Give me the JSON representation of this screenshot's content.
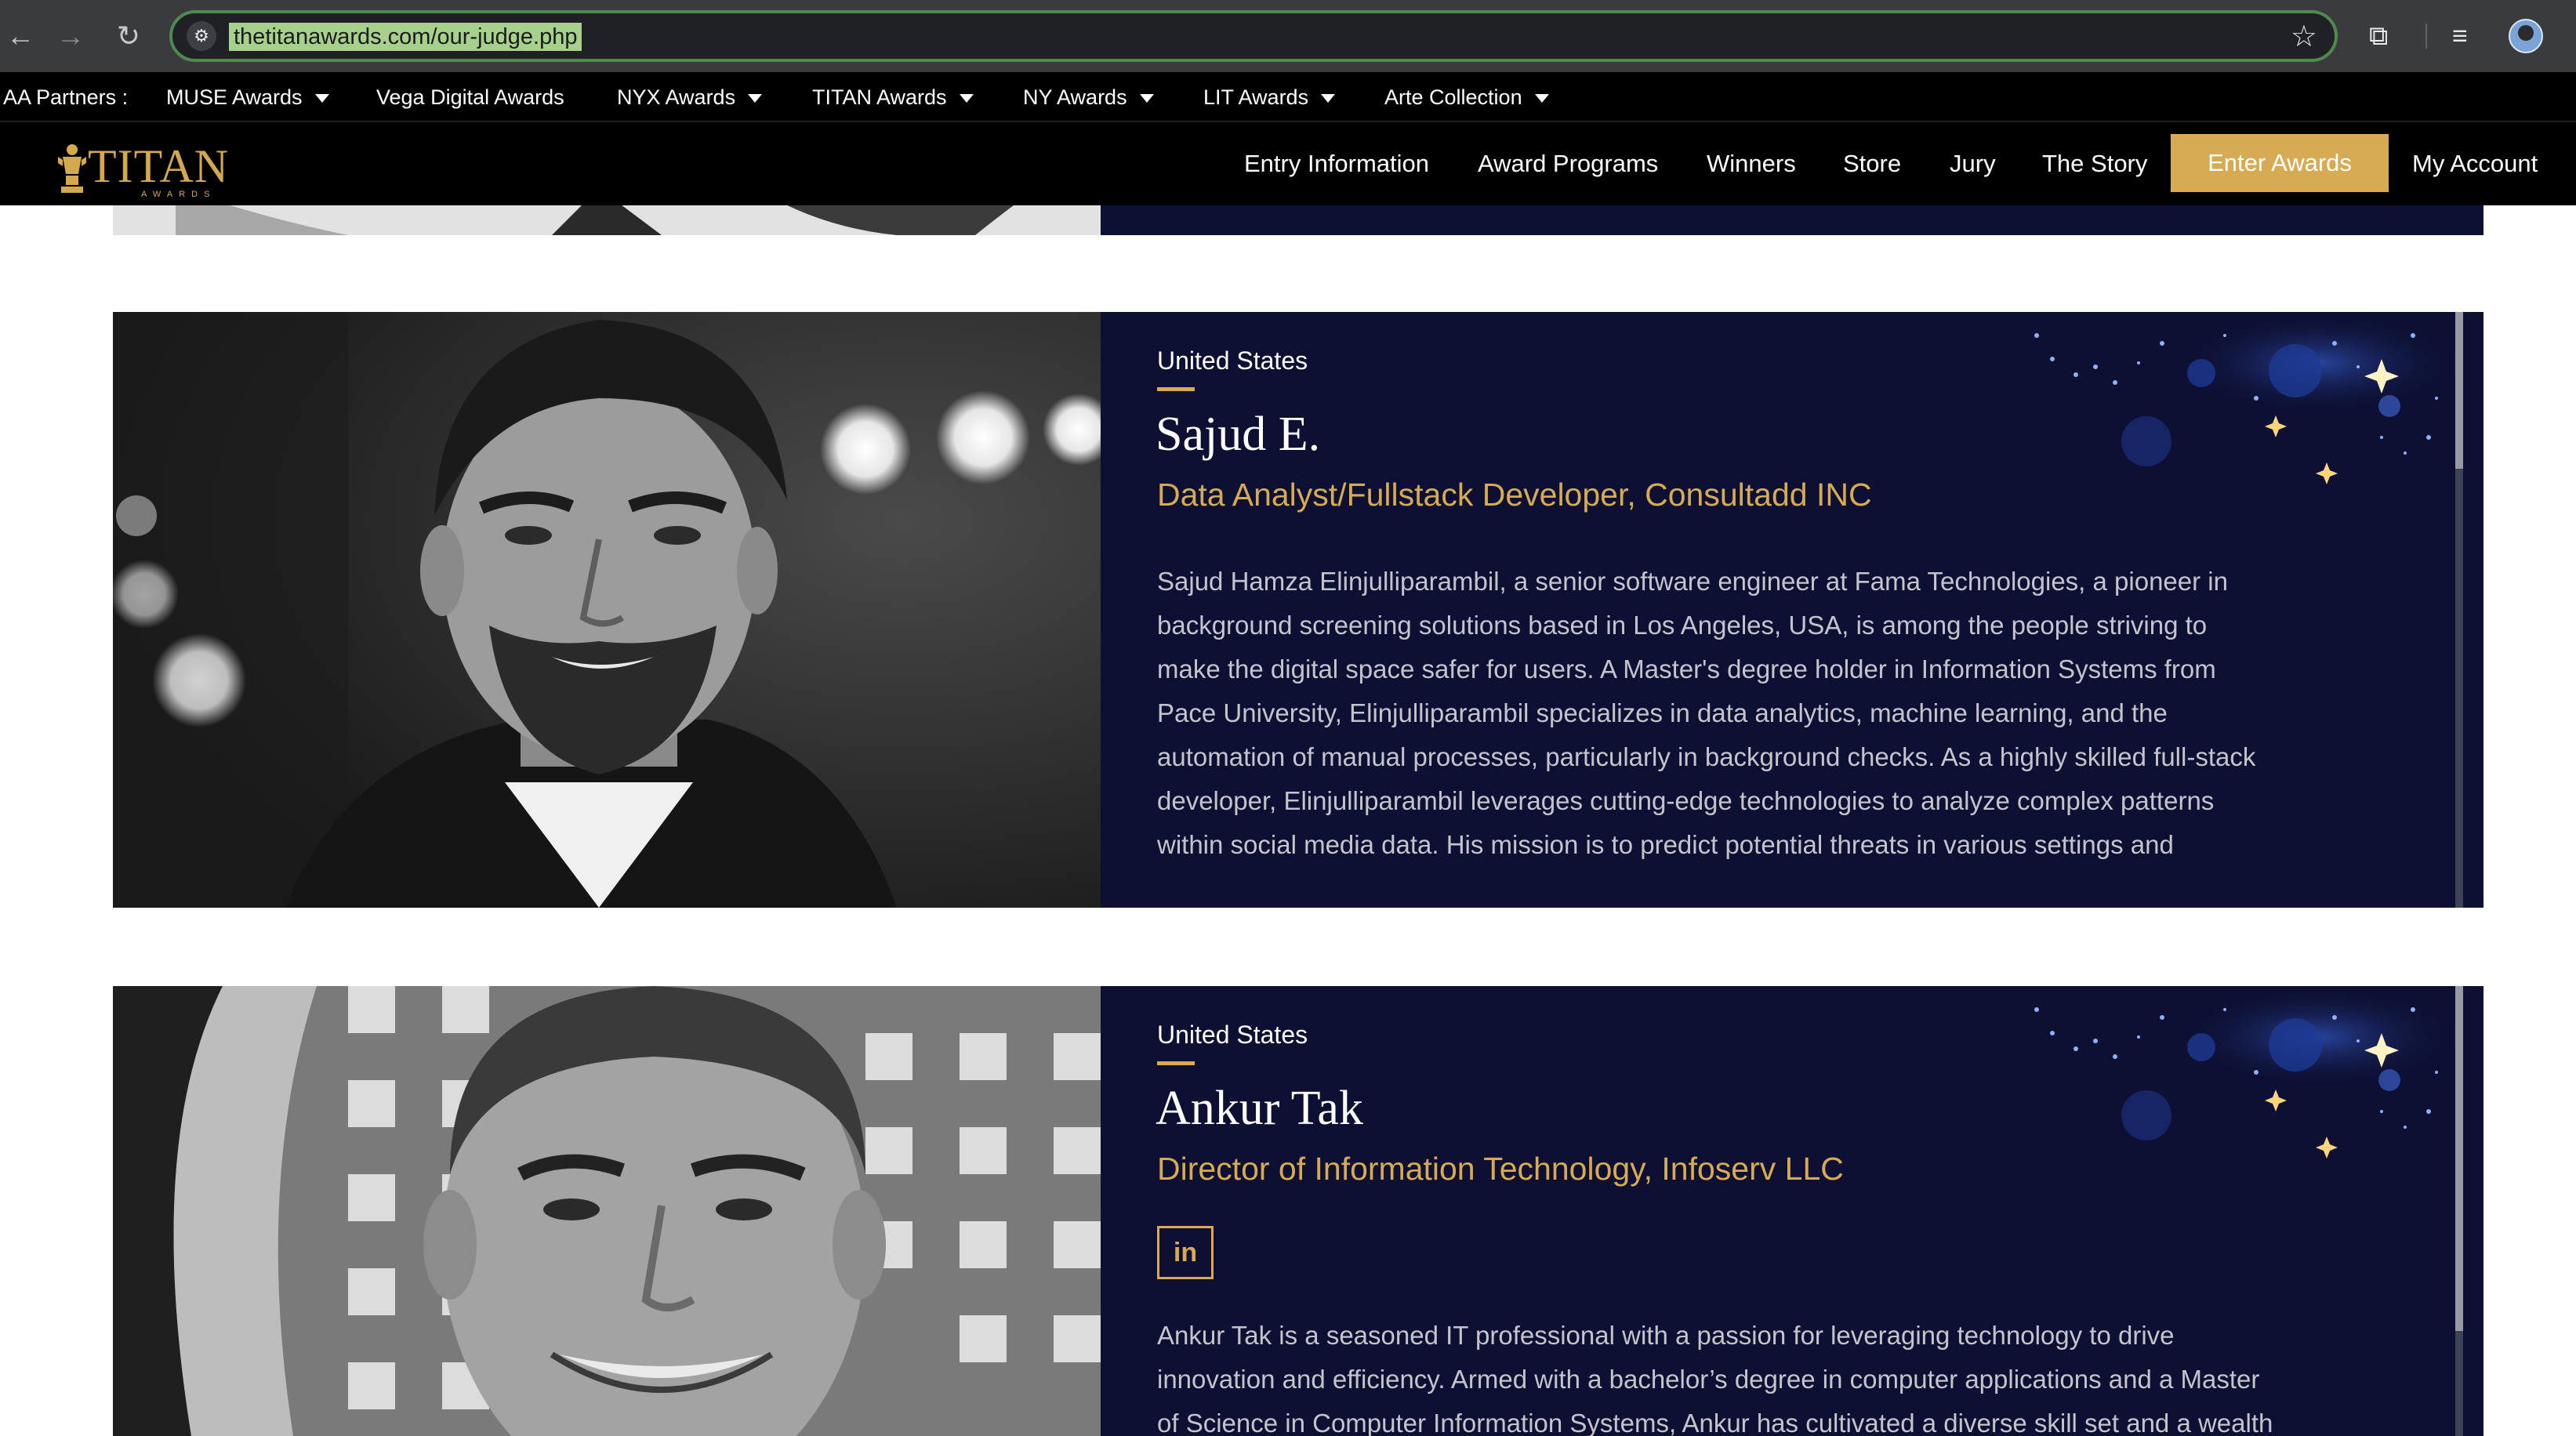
{
  "browser": {
    "url": "thetitanawards.com/our-judge.php",
    "back_icon": "←",
    "forward_icon": "→",
    "reload_icon": "↻"
  },
  "partners": {
    "label": "AA Partners :",
    "items": [
      {
        "label": "MUSE Awards",
        "dropdown": true
      },
      {
        "label": "Vega Digital Awards",
        "dropdown": false
      },
      {
        "label": "NYX Awards",
        "dropdown": true
      },
      {
        "label": "TITAN Awards",
        "dropdown": true
      },
      {
        "label": "NY Awards",
        "dropdown": true
      },
      {
        "label": "LIT Awards",
        "dropdown": true
      },
      {
        "label": "Arte Collection",
        "dropdown": true
      }
    ]
  },
  "nav": {
    "logo_text": "TITAN",
    "logo_sub": "AWARDS",
    "links": [
      "Entry Information",
      "Award Programs",
      "Winners",
      "Store",
      "Jury",
      "The Story"
    ],
    "enter_label": "Enter Awards",
    "account_label": "My Account"
  },
  "colors": {
    "accent_gold": "#d6ab54",
    "panel_navy": "#0d1033",
    "nav_black": "#000000"
  },
  "judges": [
    {
      "country": "United States",
      "name": "Sajud E.",
      "title": "Data Analyst/Fullstack Developer, Consultadd INC",
      "bio": [
        "Sajud Hamza Elinjulliparambil, a senior software engineer at Fama Technologies, a pioneer in",
        "background screening solutions based in Los Angeles, USA, is among the people striving to",
        "make the digital space safer for users. A Master's degree holder in Information Systems from",
        "Pace University, Elinjulliparambil specializes in data analytics, machine learning, and the",
        "automation of manual processes, particularly in background checks. As a highly skilled full-stack",
        "developer, Elinjulliparambil leverages cutting-edge technologies to analyze complex patterns",
        "within social media data. His mission is to predict potential threats in various settings and"
      ]
    },
    {
      "country": "United States",
      "name": "Ankur Tak",
      "title": "Director of Information Technology, Infoserv LLC",
      "linkedin_label": "in",
      "bio": [
        "Ankur Tak is a seasoned IT professional with a passion for leveraging technology to drive",
        "innovation and efficiency. Armed with a bachelor’s degree in computer applications and a Master",
        "of Science in Computer Information Systems, Ankur has cultivated a diverse skill set and a wealth"
      ]
    }
  ]
}
